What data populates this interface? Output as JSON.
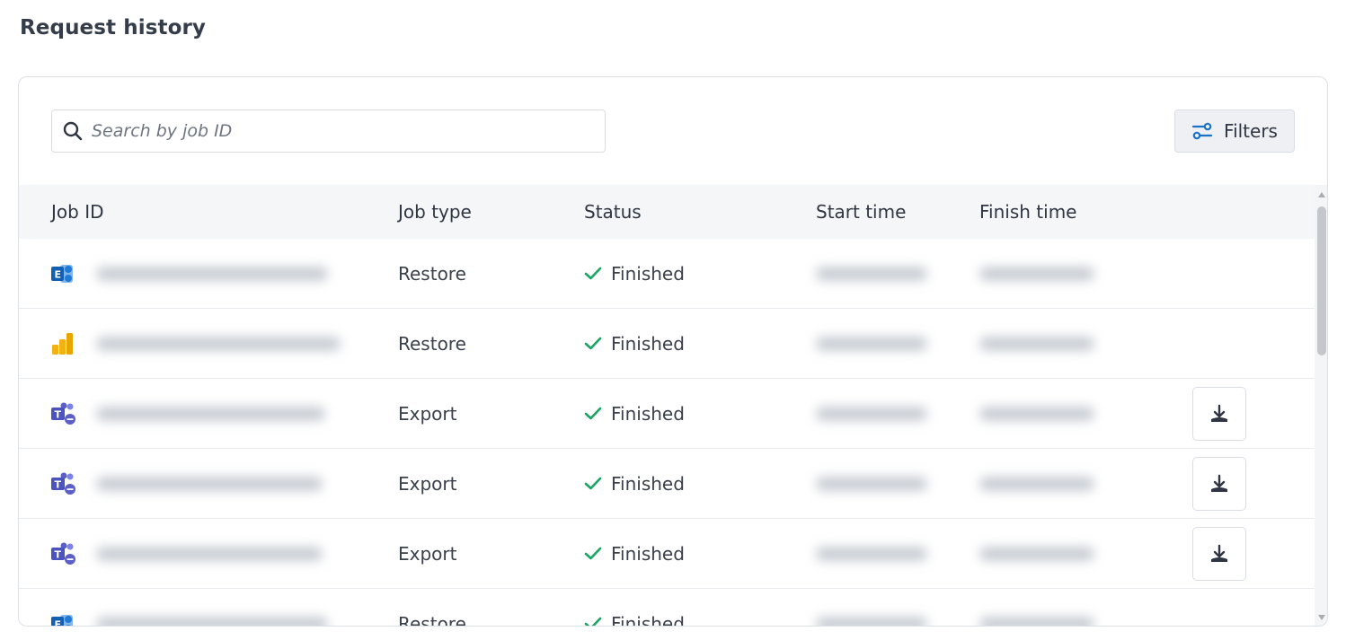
{
  "page": {
    "title": "Request history"
  },
  "search": {
    "placeholder": "Search by job ID",
    "value": ""
  },
  "filters": {
    "label": "Filters"
  },
  "table": {
    "columns": [
      "Job ID",
      "Job type",
      "Status",
      "Start time",
      "Finish time"
    ],
    "rows": [
      {
        "icon": "exchange-icon",
        "job_type": "Restore",
        "status": "Finished",
        "downloadable": false
      },
      {
        "icon": "power-bi-icon",
        "job_type": "Restore",
        "status": "Finished",
        "downloadable": false
      },
      {
        "icon": "teams-icon",
        "job_type": "Export",
        "status": "Finished",
        "downloadable": true
      },
      {
        "icon": "teams-icon",
        "job_type": "Export",
        "status": "Finished",
        "downloadable": true
      },
      {
        "icon": "teams-icon",
        "job_type": "Export",
        "status": "Finished",
        "downloadable": true
      },
      {
        "icon": "exchange-icon",
        "job_type": "Restore",
        "status": "Finished",
        "downloadable": false
      }
    ]
  },
  "colors": {
    "accent": "#1a73c8",
    "success": "#1aa562",
    "exchange_blue": "#1f7ad6",
    "powerbi_yellow": "#f2b211",
    "teams_purple": "#5b5fc7"
  }
}
